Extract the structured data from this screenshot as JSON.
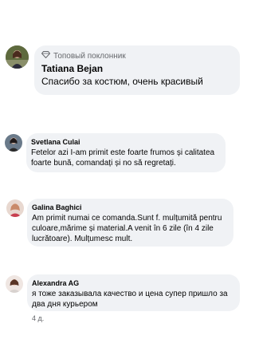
{
  "comments": [
    {
      "badge": "Топовый поклонник",
      "badge_icon": "diamond-icon",
      "name": "Tatiana Bejan",
      "text": "Спасибо за костюм, очень красивый"
    },
    {
      "name": "Svetlana Culai",
      "text": "Fetelor azi I-am primit este foarte frumos și calitatea foarte bună, comandați și no să regretați."
    },
    {
      "name": "Galina Baghici",
      "text": "Am primit numai ce comanda.Sunt f. mulțumită pentru culoare,mărime și material.A venit în 6 zile (în 4 zile lucrătoare). Mulțumesc mult."
    },
    {
      "name": "Alexandra AG",
      "text": "я тоже заказывала качество и цена супер пришло за два дня курьером",
      "time": "4 д."
    }
  ]
}
